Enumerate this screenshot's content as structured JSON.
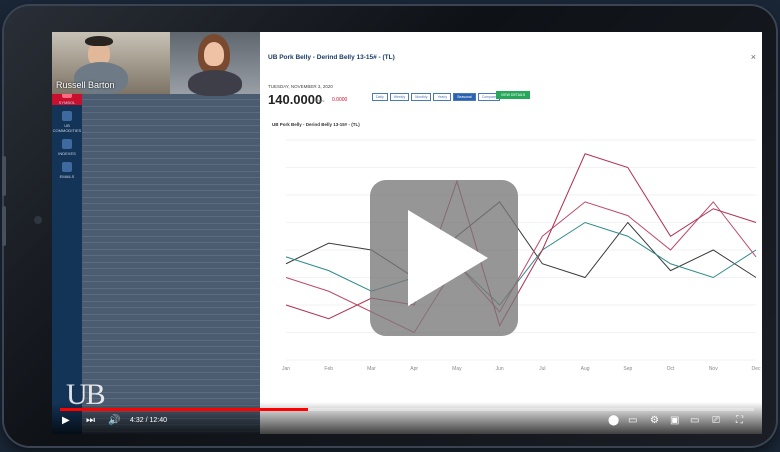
{
  "participants": [
    {
      "name": "Russell Barton"
    },
    {
      "name": ""
    }
  ],
  "sidebar": {
    "items": [
      {
        "label": "SYMBOL",
        "active": true
      },
      {
        "label": "UB COMMODITIES"
      },
      {
        "label": "INDEXES"
      },
      {
        "label": "EMAILS"
      }
    ]
  },
  "chart_header": {
    "title": "UB Pork Belly - Derind Belly 13-15# - (TL)",
    "subtitle": "",
    "date": "TUESDAY, NOVEMBER 3, 2020",
    "price": "140.0000",
    "prev_label": "Prev.",
    "change": "0.0000",
    "ranges": [
      "Daily",
      "Weekly",
      "Monthly",
      "Yearly",
      "Seasonal",
      "Compare"
    ],
    "active_range": "Seasonal",
    "view_button": "VIEW DETAILS"
  },
  "chart_data": {
    "type": "line",
    "title": "UB Pork Belly - Derind Belly 13-15# - (TL)",
    "x": [
      "Jan",
      "Feb",
      "Mar",
      "Apr",
      "May",
      "Jun",
      "Jul",
      "Aug",
      "Sep",
      "Oct",
      "Nov",
      "Dec"
    ],
    "ylim": [
      60,
      220
    ],
    "series": [
      {
        "color": "#3a3a3a",
        "values": [
          130,
          145,
          140,
          120,
          150,
          175,
          130,
          120,
          160,
          125,
          140,
          120
        ]
      },
      {
        "color": "#2e8b8b",
        "values": [
          135,
          125,
          110,
          120,
          130,
          100,
          140,
          160,
          150,
          130,
          120,
          140
        ]
      },
      {
        "color": "#c04a6a",
        "values": [
          120,
          110,
          95,
          80,
          130,
          95,
          150,
          175,
          165,
          140,
          175,
          135
        ]
      },
      {
        "color": "#b03050",
        "values": [
          100,
          90,
          105,
          100,
          190,
          85,
          140,
          210,
          200,
          150,
          170,
          160
        ]
      }
    ],
    "colors": {
      "accent": "#c8102e",
      "brand": "#143457"
    }
  },
  "player": {
    "time": "4:32 / 12:40",
    "progress": 0.357,
    "watermark": "UB"
  }
}
